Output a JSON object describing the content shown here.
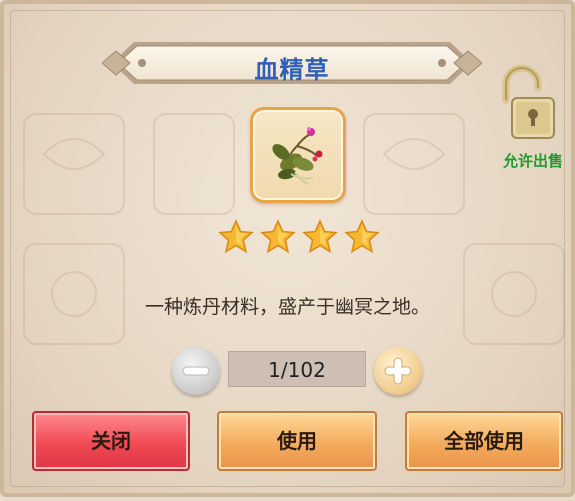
{
  "dialog": {
    "title": "血精草",
    "sell_label": "允许出售",
    "description": "一种炼丹材料，盛产于幽冥之地。",
    "rating_stars": 4,
    "quantity": "1/102",
    "buttons": {
      "close": "关闭",
      "use": "使用",
      "use_all": "全部使用"
    },
    "icons": {
      "lock": "unlocked-padlock-icon",
      "item": "blood-herb-icon",
      "minus": "minus-icon",
      "plus": "plus-icon"
    },
    "colors": {
      "title": "#2f5fb6",
      "sell_label": "#1f9a2c",
      "close_button": "#f04a55",
      "use_button": "#f4ac5d"
    }
  }
}
